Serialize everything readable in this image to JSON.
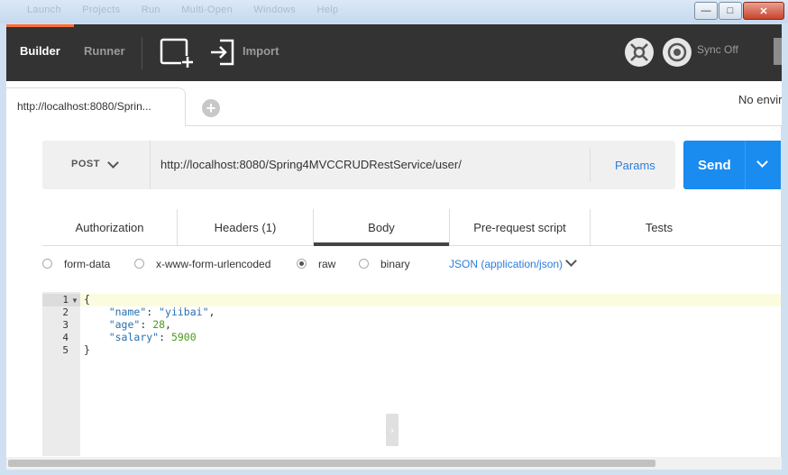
{
  "window": {
    "menu_ghost": [
      "Launch",
      "Projects",
      "Run",
      "Multi-Open",
      "Windows",
      "Help"
    ],
    "min_label": "—",
    "max_label": "□",
    "close_label": "✕"
  },
  "topbar": {
    "builder_label": "Builder",
    "runner_label": "Runner",
    "import_label": "Import",
    "sync_label": "Sync Off"
  },
  "tabs": {
    "active_tab_label": "http://localhost:8080/Sprin...",
    "add_tab_label": "+",
    "environment_label": "No envir"
  },
  "request": {
    "method": "POST",
    "url": "http://localhost:8080/Spring4MVCCRUDRestService/user/",
    "params_label": "Params",
    "send_label": "Send"
  },
  "subtabs": [
    "Authorization",
    "Headers (1)",
    "Body",
    "Pre-request script",
    "Tests"
  ],
  "body_types": {
    "form_data": "form-data",
    "urlencoded": "x-www-form-urlencoded",
    "raw": "raw",
    "binary": "binary",
    "selected": "raw",
    "content_type": "JSON (application/json)"
  },
  "editor": {
    "line_numbers": [
      "1",
      "2",
      "3",
      "4",
      "5"
    ],
    "lines": {
      "l1": "{",
      "l2_key": "\"name\"",
      "l2_val": "\"yiibai\"",
      "l3_key": "\"age\"",
      "l3_val": "28",
      "l4_key": "\"salary\"",
      "l4_val": "5900",
      "l5": "}"
    }
  },
  "colors": {
    "accent_orange": "#ff6c37",
    "send_blue": "#1a8bef",
    "link_blue": "#2a7ed9",
    "topbar_dark": "#333333"
  }
}
